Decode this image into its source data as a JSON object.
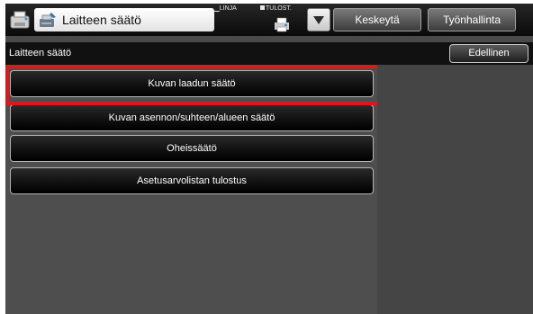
{
  "header": {
    "title": "Laitteen säätö",
    "status_linja": "LINJA",
    "status_tulost": "TULOST.",
    "buttons": {
      "keskeyta": "Keskeytä",
      "tyonhallinta": "Työnhallinta"
    }
  },
  "subheader": {
    "title": "Laitteen säätö",
    "back_button": "Edellinen"
  },
  "menu": {
    "items": [
      {
        "label": "Kuvan laadun säätö",
        "highlighted": true
      },
      {
        "label": "Kuvan asennon/suhteen/alueen säätö",
        "highlighted": false
      },
      {
        "label": "Oheissäätö",
        "highlighted": false
      },
      {
        "label": "Asetusarvolistan tulostus",
        "highlighted": false
      }
    ]
  },
  "colors": {
    "highlight": "#e0161b",
    "panel_background": "#4a4a4a",
    "topbar_background": "#111111"
  },
  "icons": {
    "app": "copier-settings-icon",
    "title": "adjust-wrench-icon",
    "printer": "printer-icon",
    "dropdown": "triangle-down-icon"
  }
}
